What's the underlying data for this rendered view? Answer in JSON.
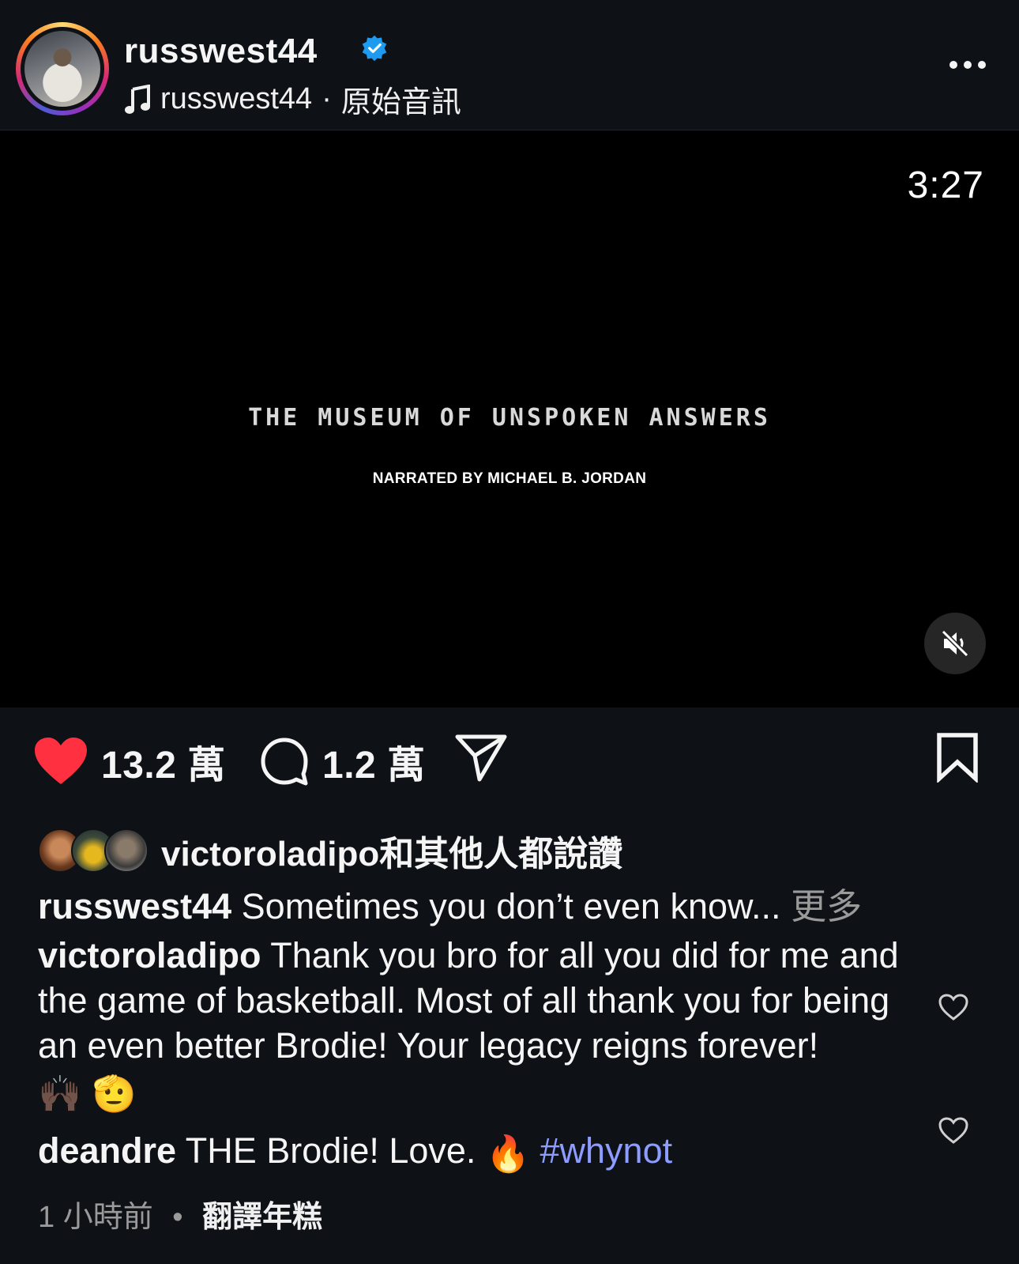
{
  "header": {
    "username": "russwest44",
    "audio_user": "russwest44",
    "audio_separator": "·",
    "audio_label": "原始音訊",
    "verified_color": "#1d9bf0"
  },
  "video": {
    "duration": "3:27",
    "title": "THE MUSEUM OF UNSPOKEN ANSWERS",
    "subtitle": "NARRATED  BY MICHAEL B. JORDAN",
    "mute_icon": "speaker-muted-icon"
  },
  "actions": {
    "like_count": "13.2 萬",
    "comment_count": "1.2 萬",
    "like_color": "#ff3040"
  },
  "likes": {
    "user": "victoroladipo",
    "suffix": "和其他人都說讚"
  },
  "caption": {
    "user": "russwest44",
    "text": "Sometimes you don’t even know...",
    "more": "更多"
  },
  "comments": [
    {
      "user": "victoroladipo",
      "text": "Thank you bro for all you did for me and the game of basketball. Most of all thank you for being an even better Brodie! Your legacy reigns forever!",
      "emoji": "🙌🏿 🫡"
    },
    {
      "user": "deandre",
      "text": "THE Brodie! Love.",
      "emoji": "🔥",
      "hashtag": "#whynot"
    }
  ],
  "meta": {
    "time": "1 小時前",
    "separator": "•",
    "translate": "翻譯年糕"
  }
}
